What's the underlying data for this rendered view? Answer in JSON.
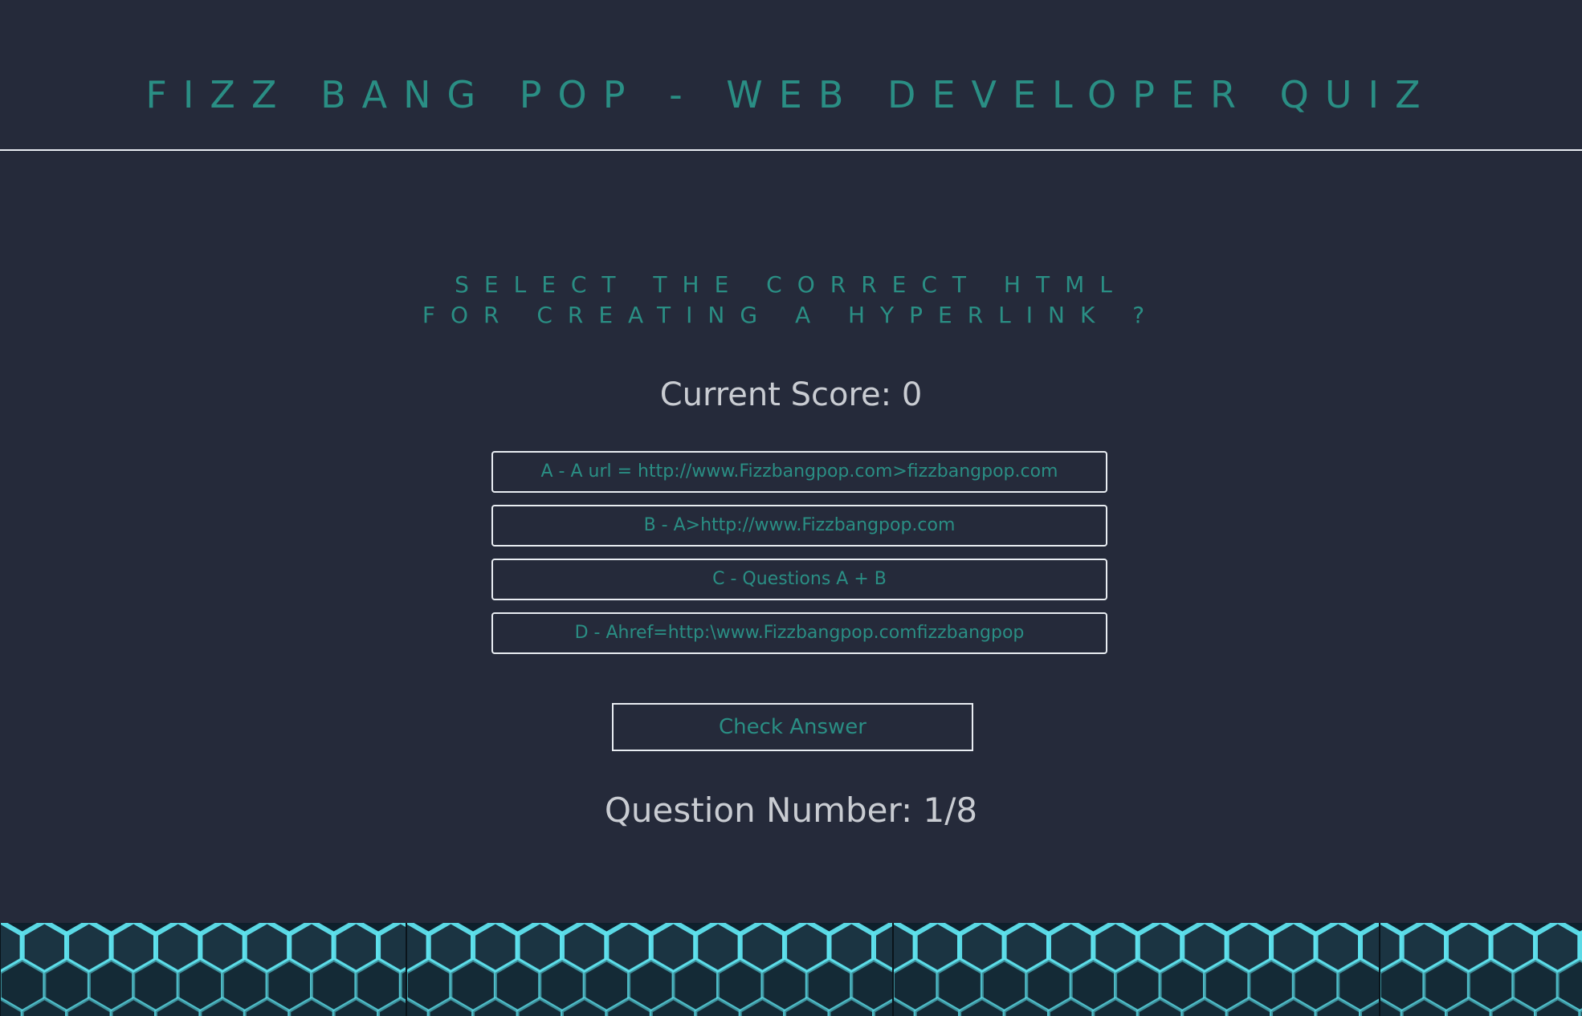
{
  "header": {
    "title": "FIZZ BANG POP - WEB DEVELOPER QUIZ"
  },
  "quiz": {
    "question_line1": "SELECT THE CORRECT HTML",
    "question_line2": "FOR CREATING A HYPERLINK ?",
    "score_text": "Current Score: 0",
    "answers": [
      "A - A url = http://www.Fizzbangpop.com>fizzbangpop.com",
      "B - A>http://www.Fizzbangpop.com",
      "C - Questions A + B",
      "D - Ahref=http:\\www.Fizzbangpop.comfizzbangpop"
    ],
    "check_label": "Check Answer",
    "question_number_text": "Question Number: 1/8"
  },
  "colors": {
    "background": "#252a3a",
    "accent": "#2a8e84",
    "text_light": "#c9ccd2",
    "border": "#e9edf2",
    "hex_glow": "#5fe3ee"
  },
  "footer": {
    "banner": "hexagon-pattern-image"
  }
}
